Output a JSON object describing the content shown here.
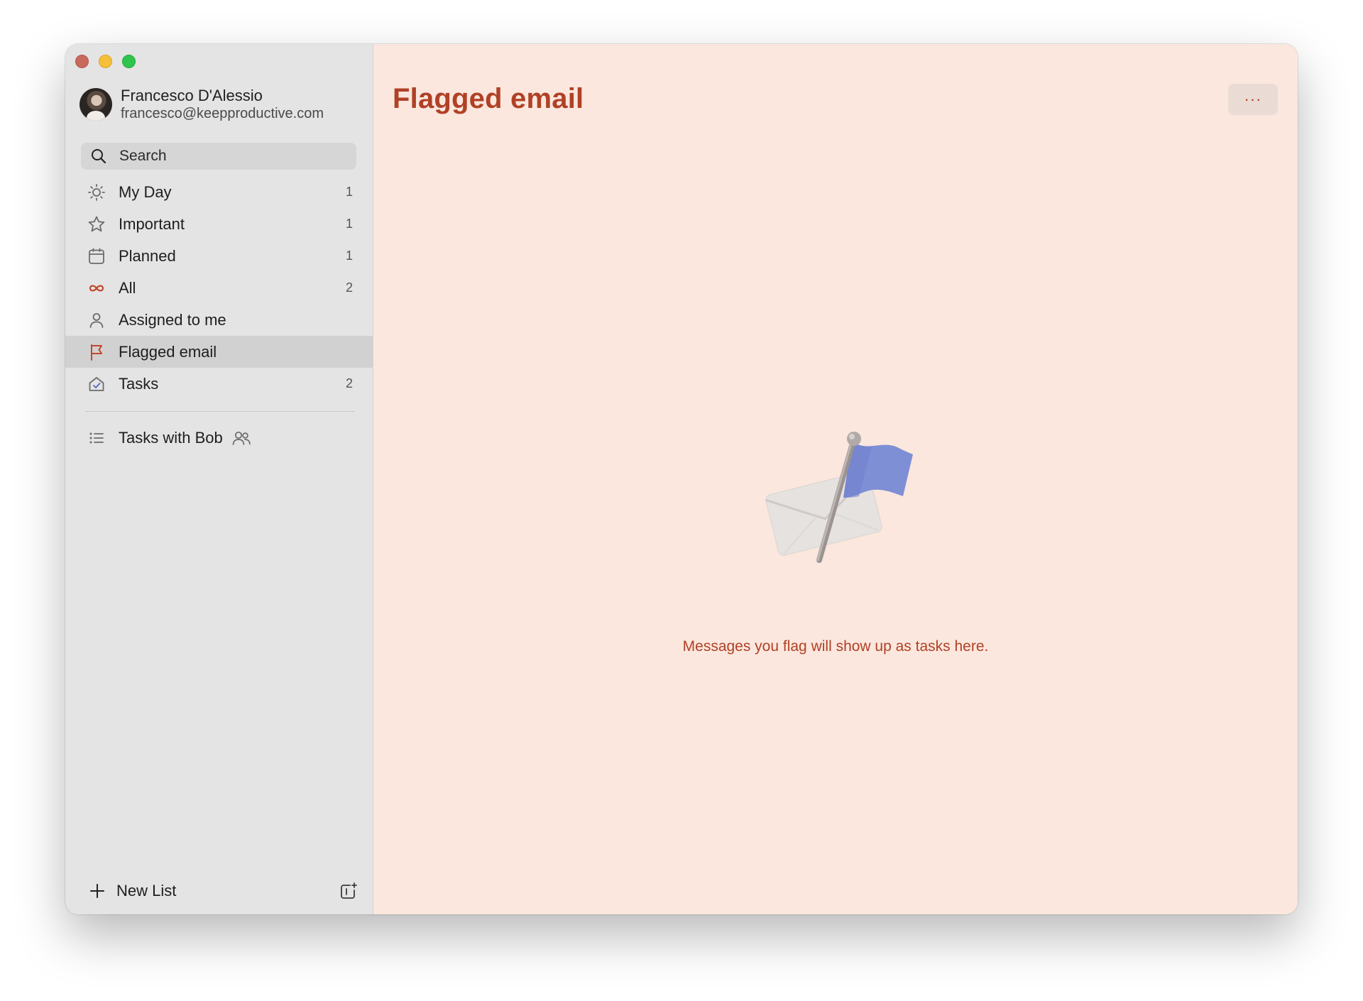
{
  "account": {
    "name": "Francesco D'Alessio",
    "email": "francesco@keepproductive.com"
  },
  "search": {
    "placeholder": "Search"
  },
  "nav": {
    "items": [
      {
        "label": "My Day",
        "count": "1",
        "icon": "sun-icon"
      },
      {
        "label": "Important",
        "count": "1",
        "icon": "star-icon"
      },
      {
        "label": "Planned",
        "count": "1",
        "icon": "calendar-icon"
      },
      {
        "label": "All",
        "count": "2",
        "icon": "infinity-icon"
      },
      {
        "label": "Assigned to me",
        "count": "",
        "icon": "person-icon"
      },
      {
        "label": "Flagged email",
        "count": "",
        "icon": "flag-icon",
        "selected": true
      },
      {
        "label": "Tasks",
        "count": "2",
        "icon": "home-check-icon"
      }
    ]
  },
  "lists": [
    {
      "label": "Tasks with Bob",
      "icon": "list-icon",
      "shared_icon": "shared-people-icon"
    }
  ],
  "footer": {
    "new_list_label": "New List",
    "new_group_icon": "new-group-icon"
  },
  "main": {
    "title": "Flagged email",
    "more_label": "···",
    "empty_message": "Messages you flag will show up as tasks here."
  },
  "colors": {
    "accent": "#b04126",
    "background": "#fbe7de",
    "sidebar": "#e4e4e4",
    "selected": "#d1d1d1",
    "flag": "#7f8fd6"
  }
}
